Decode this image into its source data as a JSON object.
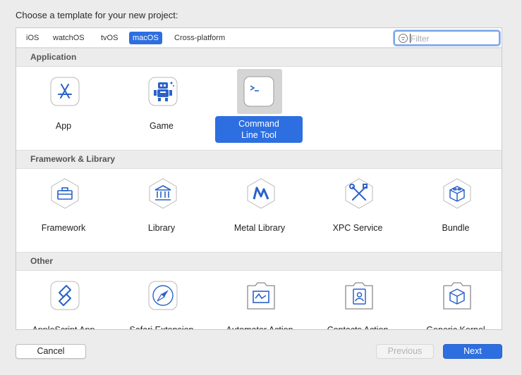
{
  "dialog": {
    "heading": "Choose a template for your new project:"
  },
  "tabs": [
    {
      "label": "iOS"
    },
    {
      "label": "watchOS"
    },
    {
      "label": "tvOS"
    },
    {
      "label": "macOS",
      "selected": true
    },
    {
      "label": "Cross-platform"
    }
  ],
  "filter": {
    "placeholder": "Filter",
    "value": ""
  },
  "sections": {
    "application": {
      "title": "Application",
      "items": [
        {
          "label": "App",
          "icon": "app-store-icon"
        },
        {
          "label": "Game",
          "icon": "game-robot-icon"
        },
        {
          "label": "Command\nLine Tool",
          "icon": "terminal-icon",
          "selected": true
        }
      ]
    },
    "framework": {
      "title": "Framework & Library",
      "items": [
        {
          "label": "Framework",
          "icon": "toolbox-icon"
        },
        {
          "label": "Library",
          "icon": "building-columns-icon"
        },
        {
          "label": "Metal Library",
          "icon": "metal-icon"
        },
        {
          "label": "XPC Service",
          "icon": "wrench-screwdriver-icon"
        },
        {
          "label": "Bundle",
          "icon": "lego-brick-icon"
        }
      ]
    },
    "other": {
      "title": "Other",
      "items": [
        {
          "label": "AppleScript App",
          "icon": "applescript-icon"
        },
        {
          "label": "Safari Extension",
          "icon": "compass-icon"
        },
        {
          "label": "Automator Action",
          "icon": "automator-icon"
        },
        {
          "label": "Contacts Action",
          "icon": "contacts-icon"
        },
        {
          "label": "Generic Kernel",
          "icon": "kernel-brick-icon"
        }
      ]
    }
  },
  "buttons": {
    "cancel": "Cancel",
    "previous": "Previous",
    "next": "Next"
  },
  "colors": {
    "accent": "#2d6fe0",
    "icon_blue": "#2a62c9",
    "selection_gray": "#d5d5d5"
  }
}
